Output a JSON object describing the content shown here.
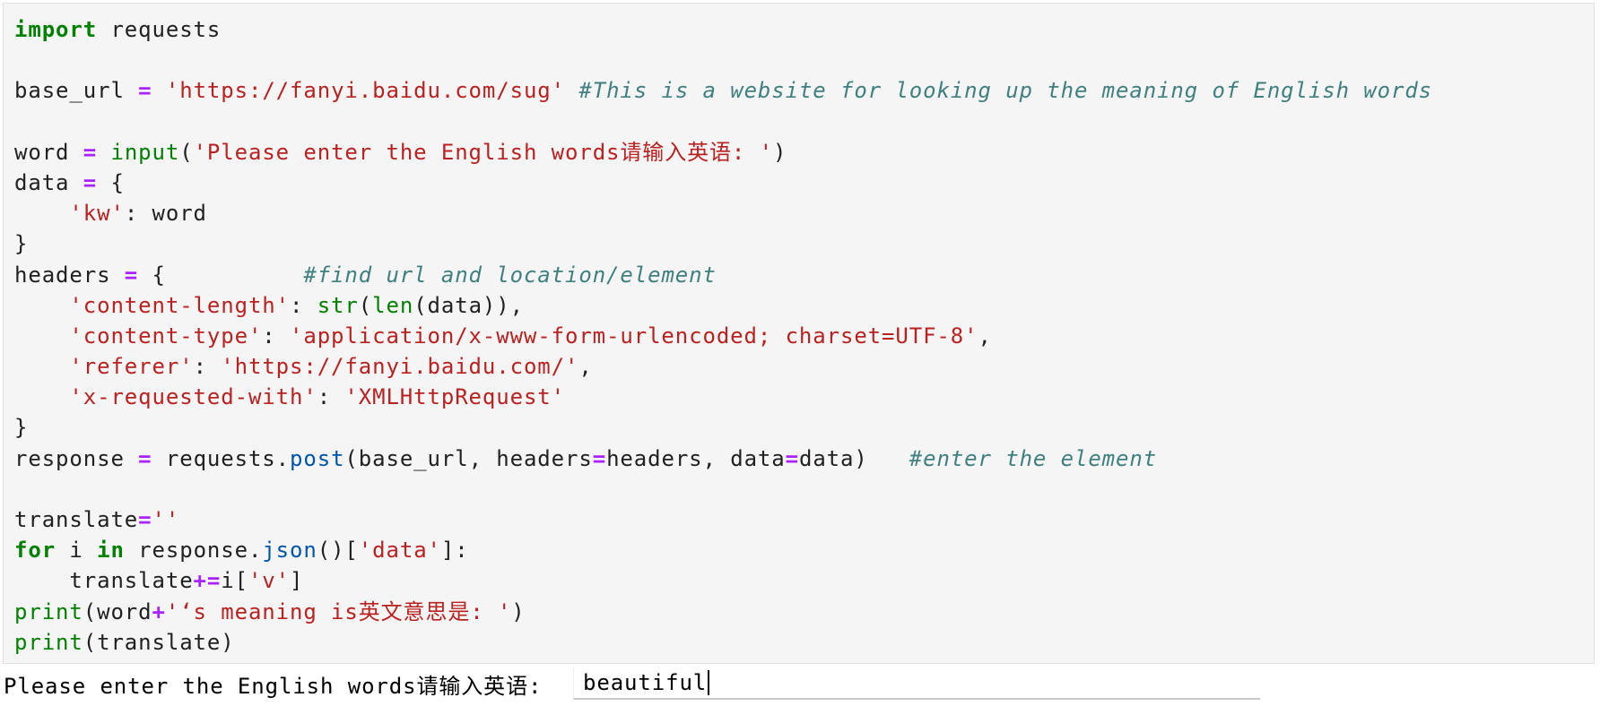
{
  "cell": {
    "lines": [
      [
        [
          "kw",
          "import"
        ],
        [
          "t",
          " requests"
        ]
      ],
      [],
      [
        [
          "t",
          "base_url "
        ],
        [
          "op",
          "="
        ],
        [
          "t",
          " "
        ],
        [
          "str",
          "'https://fanyi.baidu.com/sug'"
        ],
        [
          "t",
          " "
        ],
        [
          "com",
          "#This is a website for looking up the meaning of English words"
        ]
      ],
      [],
      [
        [
          "t",
          "word "
        ],
        [
          "op",
          "="
        ],
        [
          "t",
          " "
        ],
        [
          "bi",
          "input"
        ],
        [
          "t",
          "("
        ],
        [
          "str",
          "'Please enter the English words请输入英语: '"
        ],
        [
          "t",
          ")"
        ]
      ],
      [
        [
          "t",
          "data "
        ],
        [
          "op",
          "="
        ],
        [
          "t",
          " {"
        ]
      ],
      [
        [
          "t",
          "    "
        ],
        [
          "str",
          "'kw'"
        ],
        [
          "t",
          ": word"
        ]
      ],
      [
        [
          "t",
          "}"
        ]
      ],
      [
        [
          "t",
          "headers "
        ],
        [
          "op",
          "="
        ],
        [
          "t",
          " {          "
        ],
        [
          "com",
          "#find url and location/element"
        ]
      ],
      [
        [
          "t",
          "    "
        ],
        [
          "str",
          "'content-length'"
        ],
        [
          "t",
          ": "
        ],
        [
          "bi",
          "str"
        ],
        [
          "t",
          "("
        ],
        [
          "bi",
          "len"
        ],
        [
          "t",
          "(data)),"
        ]
      ],
      [
        [
          "t",
          "    "
        ],
        [
          "str",
          "'content-type'"
        ],
        [
          "t",
          ": "
        ],
        [
          "str",
          "'application/x-www-form-urlencoded; charset=UTF-8'"
        ],
        [
          "t",
          ","
        ]
      ],
      [
        [
          "t",
          "    "
        ],
        [
          "str",
          "'referer'"
        ],
        [
          "t",
          ": "
        ],
        [
          "str",
          "'https://fanyi.baidu.com/'"
        ],
        [
          "t",
          ","
        ]
      ],
      [
        [
          "t",
          "    "
        ],
        [
          "str",
          "'x-requested-with'"
        ],
        [
          "t",
          ": "
        ],
        [
          "str",
          "'XMLHttpRequest'"
        ]
      ],
      [
        [
          "t",
          "}"
        ]
      ],
      [
        [
          "t",
          "response "
        ],
        [
          "op",
          "="
        ],
        [
          "t",
          " requests."
        ],
        [
          "prop",
          "post"
        ],
        [
          "t",
          "(base_url, headers"
        ],
        [
          "op",
          "="
        ],
        [
          "t",
          "headers, data"
        ],
        [
          "op",
          "="
        ],
        [
          "t",
          "data)   "
        ],
        [
          "com",
          "#enter the element"
        ]
      ],
      [],
      [
        [
          "t",
          "translate"
        ],
        [
          "op",
          "="
        ],
        [
          "str",
          "''"
        ]
      ],
      [
        [
          "kw",
          "for"
        ],
        [
          "t",
          " i "
        ],
        [
          "kw",
          "in"
        ],
        [
          "t",
          " response."
        ],
        [
          "prop",
          "json"
        ],
        [
          "t",
          "()["
        ],
        [
          "str",
          "'data'"
        ],
        [
          "t",
          "]:"
        ]
      ],
      [
        [
          "t",
          "    translate"
        ],
        [
          "op",
          "+="
        ],
        [
          "t",
          "i["
        ],
        [
          "str",
          "'v'"
        ],
        [
          "t",
          "]"
        ]
      ],
      [
        [
          "bi",
          "print"
        ],
        [
          "t",
          "(word"
        ],
        [
          "op",
          "+"
        ],
        [
          "str",
          "'‘s meaning is英文意思是: '"
        ],
        [
          "t",
          ")"
        ]
      ],
      [
        [
          "bi",
          "print"
        ],
        [
          "t",
          "(translate)"
        ]
      ]
    ]
  },
  "output": {
    "prompt": "Please enter the English words请输入英语: ",
    "input_value": "beautiful"
  }
}
